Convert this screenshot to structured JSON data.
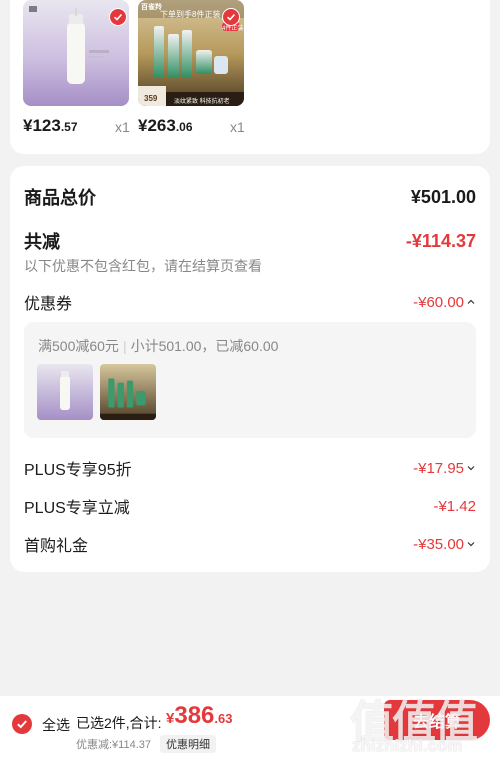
{
  "products": [
    {
      "price_int": "¥123",
      "price_dec": ".57",
      "qty": "x1",
      "thumb": "white-bottle-product-image"
    },
    {
      "price_int": "¥263",
      "price_dec": ".06",
      "qty": "x1",
      "thumb": "skincare-set-product-image",
      "banner_brand": "百雀羚",
      "banner_top": "下单到手8件正装",
      "banner_badge": "4件正装",
      "banner_price": "359",
      "banner_bottom": "淡纹紧致 科技抗初老"
    }
  ],
  "summary": {
    "goods_total_label": "商品总价",
    "goods_total_value": "¥501.00",
    "total_discount_label": "共减",
    "total_discount_value": "-¥114.37",
    "discount_note": "以下优惠不包含红包，请在结算页查看",
    "coupon_label": "优惠券",
    "coupon_value": "-¥60.00",
    "coupon_rule": "满500减60元",
    "coupon_subtotal": "小计501.00，已减60.00",
    "plus95_label": "PLUS专享95折",
    "plus95_value": "-¥17.95",
    "plus_instant_label": "PLUS专享立减",
    "plus_instant_value": "-¥1.42",
    "first_buy_label": "首购礼金",
    "first_buy_value": "-¥35.00"
  },
  "bottom": {
    "select_all": "全选",
    "selected_count": "已选2件,合计:",
    "total_currency": "¥",
    "total_int": "386",
    "total_dec": ".63",
    "saved": "优惠减:¥114.37",
    "detail_button": "优惠明细",
    "checkout_button": "去结算",
    "watermark_text": "值值值",
    "watermark_url": "zhizhizhi.com"
  },
  "colors": {
    "accent": "#e4393c",
    "muted": "#888888",
    "background": "#f2f2f2"
  }
}
